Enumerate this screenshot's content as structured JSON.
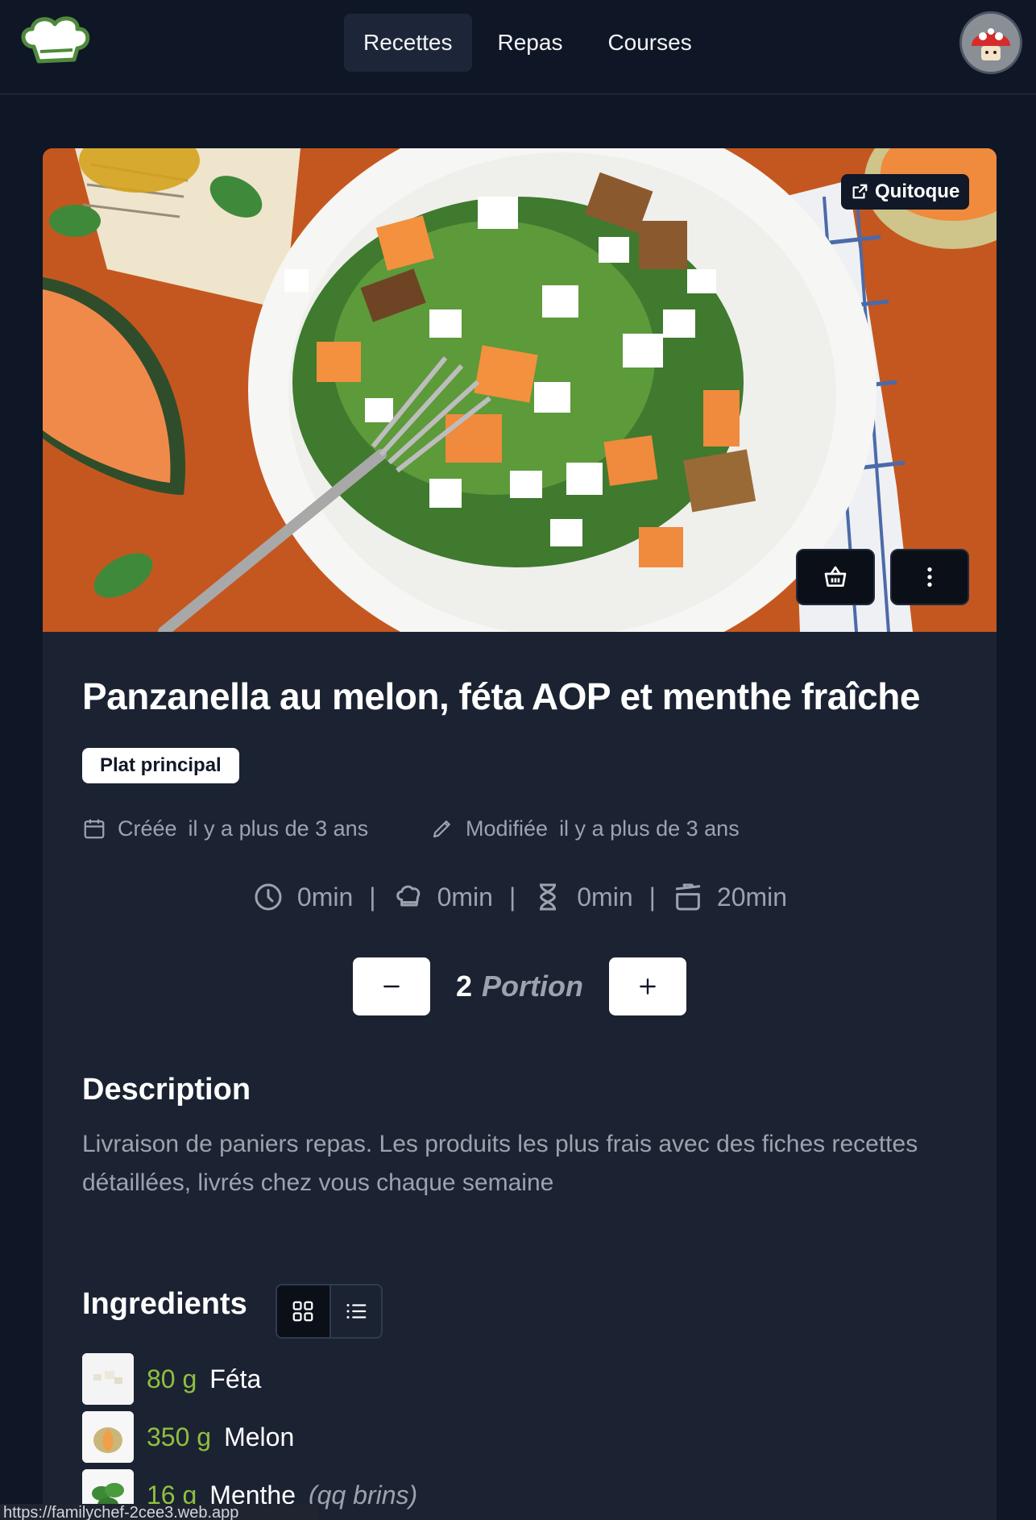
{
  "nav": {
    "items": [
      {
        "label": "Recettes",
        "active": true
      },
      {
        "label": "Repas",
        "active": false
      },
      {
        "label": "Courses",
        "active": false
      }
    ]
  },
  "recipe": {
    "source_label": "Quitoque",
    "title": "Panzanella au melon, féta AOP et menthe fraîche",
    "category": "Plat principal",
    "created_label": "Créée",
    "created_value": "il y a plus de 3 ans",
    "modified_label": "Modifiée",
    "modified_value": "il y a plus de 3 ans",
    "times": {
      "total": "0min",
      "prep": "0min",
      "rest": "0min",
      "cook": "20min",
      "separator": "|"
    },
    "portion": {
      "count": "2",
      "unit": "Portion"
    },
    "description_heading": "Description",
    "description": "Livraison de paniers repas. Les produits les plus frais avec des fiches recettes détaillées, livrés chez vous chaque semaine",
    "ingredients_heading": "Ingredients",
    "ingredients": [
      {
        "qty": "80 g",
        "name": "Féta",
        "note": ""
      },
      {
        "qty": "350 g",
        "name": "Melon",
        "note": ""
      },
      {
        "qty": "16 g",
        "name": "Menthe",
        "note": "(qq brins)"
      }
    ]
  },
  "statusbar": {
    "url": "https://familychef-2cee3.web.app"
  },
  "colors": {
    "background": "#0f1626",
    "card": "#1b2332",
    "quantity": "#8fbf3f",
    "muted": "#9ca3af"
  }
}
